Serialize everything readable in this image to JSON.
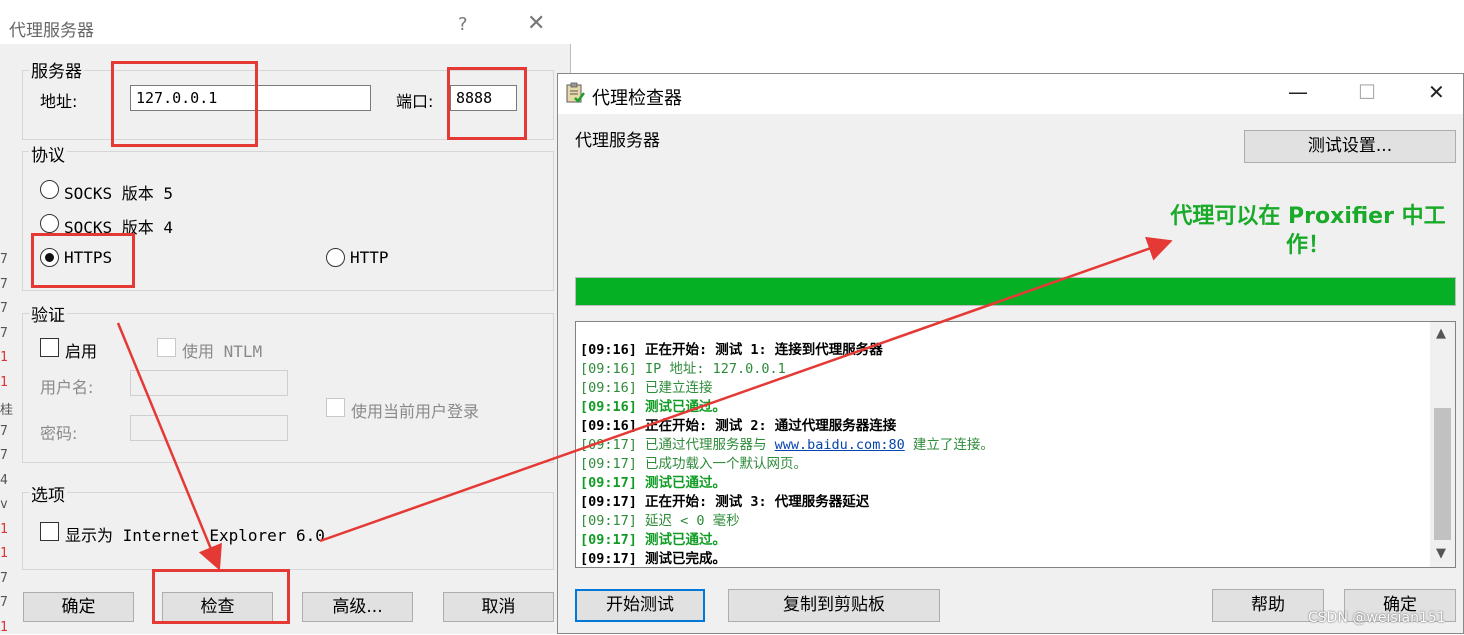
{
  "background": {
    "edge_chars": [
      "7",
      "7",
      "7",
      "7",
      "1",
      "1",
      "桂",
      "7",
      "7",
      "4",
      "v",
      "1",
      "1",
      "7",
      "7",
      "1"
    ]
  },
  "proxy_server_dialog": {
    "title": "代理服务器",
    "help_glyph": "?",
    "close_glyph": "✕",
    "server_group": {
      "label": "服务器",
      "address_label": "地址:",
      "address_value": "127.0.0.1",
      "port_label": "端口:",
      "port_value": "8888"
    },
    "protocol_group": {
      "label": "协议",
      "options": [
        {
          "label": "SOCKS 版本 5",
          "selected": false
        },
        {
          "label": "SOCKS 版本 4",
          "selected": false
        },
        {
          "label": "HTTPS",
          "selected": true
        },
        {
          "label": "HTTP",
          "selected": false
        }
      ]
    },
    "auth_group": {
      "label": "验证",
      "enable_label": "启用",
      "ntlm_label": "使用 NTLM",
      "username_label": "用户名:",
      "password_label": "密码:",
      "current_user_label": "使用当前用户登录"
    },
    "options_group": {
      "label": "选项",
      "show_as_ie_label": "显示为 Internet Explorer 6.0"
    },
    "buttons": {
      "ok": "确定",
      "check": "检查",
      "advanced": "高级...",
      "cancel": "取消"
    }
  },
  "proxy_checker": {
    "title": "代理检查器",
    "minimize_glyph": "—",
    "maximize_glyph": "☐",
    "close_glyph": "✕",
    "section_label": "代理服务器",
    "test_settings_button": "测试设置...",
    "status_message": "代理可以在 Proxifier 中工作！",
    "progress_percent": 100,
    "progress_color": "#06b025",
    "log": [
      {
        "style": "bold",
        "text": "[09:16] 正在开始: 测试 1: 连接到代理服务器"
      },
      {
        "style": "info",
        "text": "[09:16] IP 地址: 127.0.0.1"
      },
      {
        "style": "info",
        "text": "[09:16] 已建立连接"
      },
      {
        "style": "pass",
        "text": "[09:16] 测试已通过。"
      },
      {
        "style": "bold",
        "text": "[09:16] 正在开始: 测试 2: 通过代理服务器连接"
      },
      {
        "style": "info",
        "text_before": "[09:17] 已通过代理服务器与 ",
        "link": "www.baidu.com:80",
        "text_after": " 建立了连接。"
      },
      {
        "style": "info",
        "text": "[09:17] 已成功载入一个默认网页。"
      },
      {
        "style": "pass",
        "text": "[09:17] 测试已通过。"
      },
      {
        "style": "bold",
        "text": "[09:17] 正在开始: 测试 3: 代理服务器延迟"
      },
      {
        "style": "info",
        "text": "[09:17] 延迟 < 0 毫秒"
      },
      {
        "style": "pass",
        "text": "[09:17] 测试已通过。"
      },
      {
        "style": "bold",
        "text": "[09:17] 测试已完成。"
      }
    ],
    "buttons": {
      "start_test": "开始测试",
      "copy_clipboard": "复制到剪贴板",
      "help": "帮助",
      "ok": "确定"
    }
  },
  "watermark": "CSDN @weisian151",
  "annotation_color": "#e53935"
}
